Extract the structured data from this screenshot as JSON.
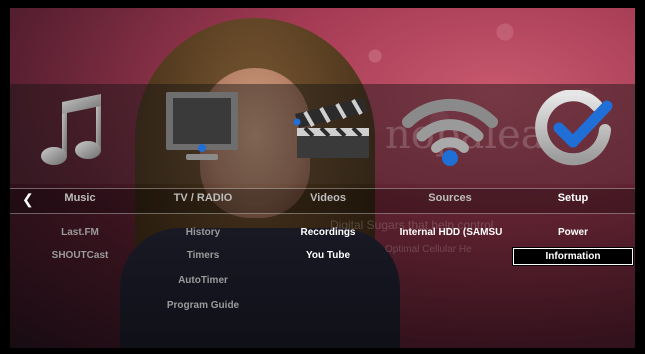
{
  "background_watermark": {
    "logo_text": "nopalea",
    "line1": "Digital Sugars that help control",
    "line2": "Optimal Cellular He"
  },
  "menu": {
    "categories": [
      {
        "label": "Music",
        "icon": "music-note-icon"
      },
      {
        "label": "TV / RADIO",
        "icon": "tv-monitor-icon"
      },
      {
        "label": "Videos",
        "icon": "clapperboard-icon"
      },
      {
        "label": "Sources",
        "icon": "wifi-signal-icon"
      },
      {
        "label": "Setup",
        "icon": "checkmark-icon"
      }
    ],
    "selected_category": "Setup",
    "submenus": {
      "music": [
        "Last.FM",
        "SHOUTCast"
      ],
      "tv_radio": [
        "History",
        "Timers",
        "AutoTimer",
        "Program Guide"
      ],
      "videos": [
        "Recordings",
        "You Tube"
      ],
      "sources": [
        "Internal HDD (SAMSU"
      ],
      "setup": [
        "Power",
        "Information"
      ]
    },
    "selected_item": "Information",
    "left_arrow": "❮"
  },
  "colors": {
    "accent_blue": "#1f6fd6",
    "selected_box": "#000000",
    "text_active": "#ffffff",
    "text_inactive": "#9a9a9a"
  }
}
